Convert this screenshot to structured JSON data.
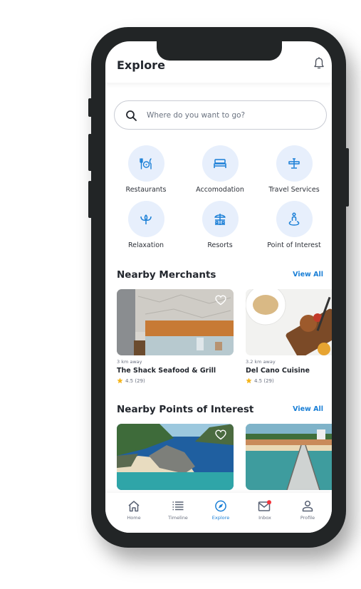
{
  "header": {
    "title": "Explore",
    "bell_icon": "bell-icon"
  },
  "search": {
    "placeholder": "Where do you want to go?",
    "value": "",
    "icon": "search-icon"
  },
  "categories": [
    {
      "label": "Restaurants",
      "icon": "restaurant-icon"
    },
    {
      "label": "Accomodation",
      "icon": "bed-icon"
    },
    {
      "label": "Travel Services",
      "icon": "airplane-icon"
    },
    {
      "label": "Relaxation",
      "icon": "lotus-icon"
    },
    {
      "label": "Resorts",
      "icon": "resort-umbrella-icon"
    },
    {
      "label": "Point of Interest",
      "icon": "location-person-icon"
    }
  ],
  "merchants": {
    "title": "Nearby Merchants",
    "view_all": "View All",
    "items": [
      {
        "distance": "3 km away",
        "name": "The Shack Seafood & Grill",
        "rating": "4.5 (29)",
        "favorite": false
      },
      {
        "distance": "3.2 km away",
        "name": "Del Cano Cuisine",
        "rating": "4.5 (29)",
        "favorite": false
      }
    ]
  },
  "points_of_interest": {
    "title": "Nearby Points of Interest",
    "view_all": "View All",
    "items": [
      {
        "image": "island-lagoon-photo",
        "favorite": false
      },
      {
        "image": "beach-pier-photo",
        "favorite": false
      }
    ]
  },
  "nav": {
    "active": "Explore",
    "items": [
      {
        "label": "Home",
        "icon": "home-icon"
      },
      {
        "label": "Timeline",
        "icon": "list-icon"
      },
      {
        "label": "Explore",
        "icon": "compass-icon"
      },
      {
        "label": "Inbox",
        "icon": "mail-icon",
        "badge": true
      },
      {
        "label": "Profile",
        "icon": "user-icon"
      }
    ]
  },
  "colors": {
    "accent": "#1a7fd6",
    "category_bg": "#e7effc",
    "badge": "#f2333a",
    "phone_body": "#222526"
  }
}
